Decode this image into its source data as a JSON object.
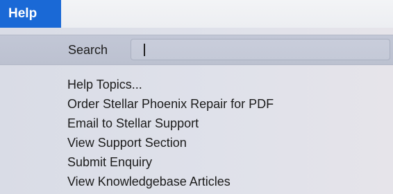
{
  "menubar": {
    "help_label": "Help"
  },
  "search": {
    "label": "Search",
    "value": ""
  },
  "menu": {
    "items": [
      {
        "label": "Help Topics..."
      },
      {
        "label": "Order Stellar Phoenix Repair for PDF"
      },
      {
        "label": "Email to Stellar Support"
      },
      {
        "label": "View Support Section"
      },
      {
        "label": "Submit Enquiry"
      },
      {
        "label": "View Knowledgebase Articles"
      }
    ]
  },
  "colors": {
    "menu_highlight": "#1a69d6",
    "search_row_bg": "#c0c5d4",
    "menu_bg": "#dcdfe8"
  }
}
